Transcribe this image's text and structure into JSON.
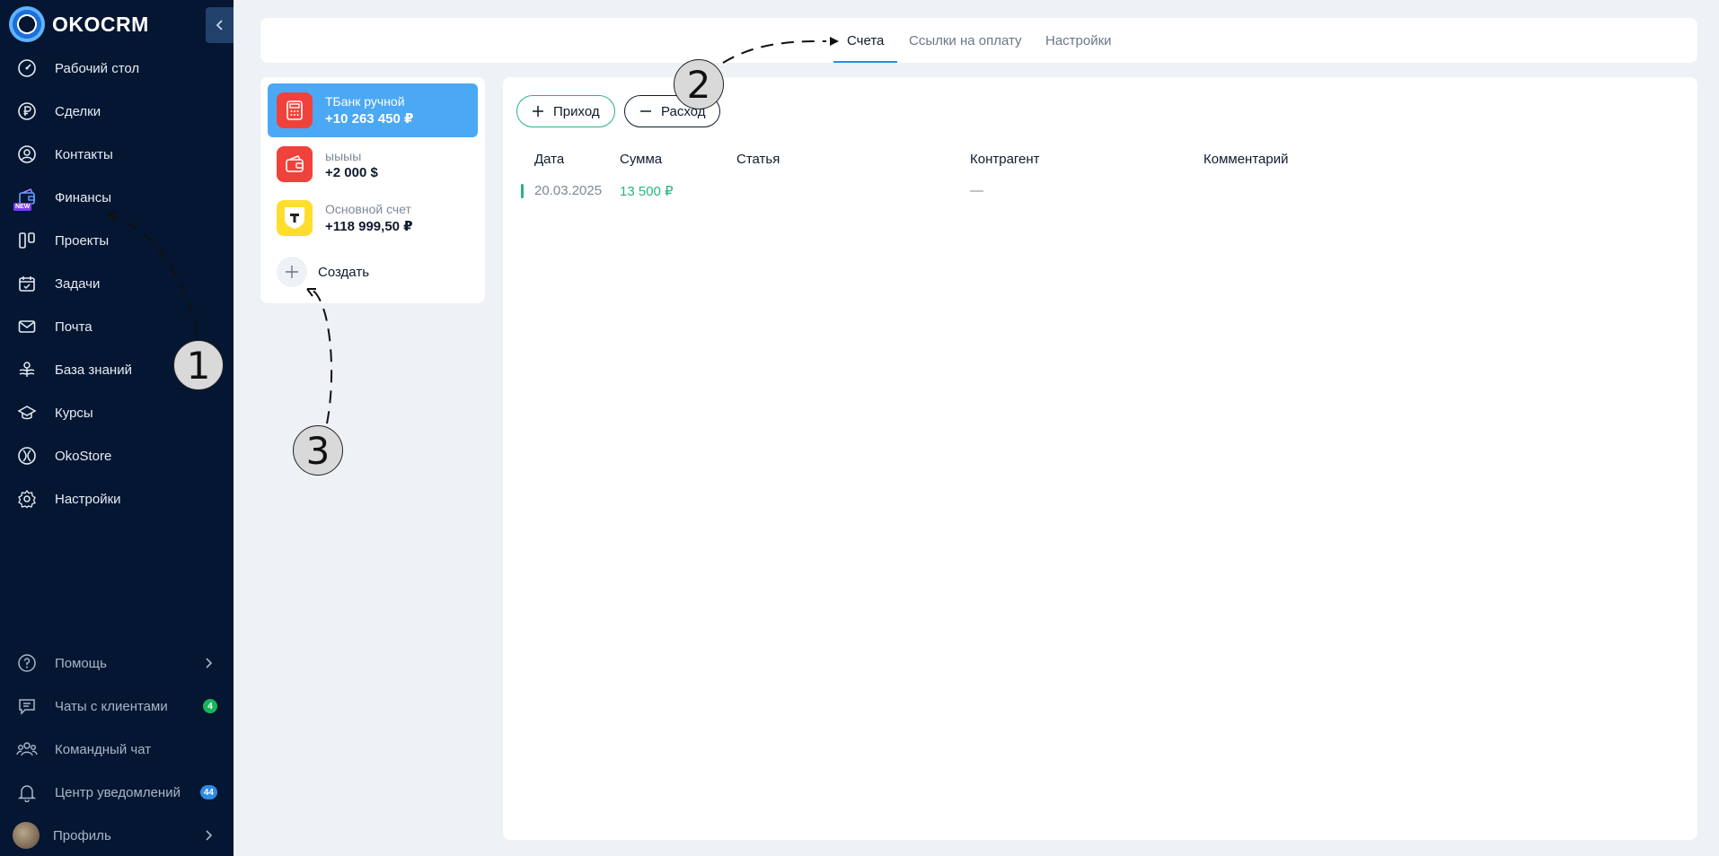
{
  "app": {
    "logo_text": "OKOCRM"
  },
  "sidebar": {
    "items": [
      {
        "label": "Рабочий стол",
        "icon": "dashboard-icon"
      },
      {
        "label": "Сделки",
        "icon": "ruble-icon"
      },
      {
        "label": "Контакты",
        "icon": "contact-icon"
      },
      {
        "label": "Финансы",
        "icon": "finance-icon",
        "badge": "NEW"
      },
      {
        "label": "Проекты",
        "icon": "projects-icon"
      },
      {
        "label": "Задачи",
        "icon": "tasks-icon"
      },
      {
        "label": "Почта",
        "icon": "mail-icon"
      },
      {
        "label": "База знаний",
        "icon": "knowledge-icon"
      },
      {
        "label": "Курсы",
        "icon": "courses-icon"
      },
      {
        "label": "OkoStore",
        "icon": "store-icon"
      },
      {
        "label": "Настройки",
        "icon": "settings-icon"
      }
    ],
    "bottom": [
      {
        "label": "Помощь",
        "icon": "help-icon"
      },
      {
        "label": "Чаты с клиентами",
        "icon": "chat-icon",
        "count": "4"
      },
      {
        "label": "Командный чат",
        "icon": "team-icon"
      },
      {
        "label": "Центр уведомлений",
        "icon": "bell-icon",
        "count": "44"
      },
      {
        "label": "Профиль",
        "icon": "avatar"
      }
    ]
  },
  "tabs": [
    {
      "label": "Счета",
      "active": true
    },
    {
      "label": "Ссылки на оплату",
      "active": false
    },
    {
      "label": "Настройки",
      "active": false
    }
  ],
  "accounts": [
    {
      "name": "ТБанк ручной",
      "balance": "+10 263 450 ₽",
      "icon": "calculator-icon",
      "color": "#f0423a"
    },
    {
      "name": "ыыыы",
      "balance": "+2 000 $",
      "icon": "wallet-icon",
      "color": "#f0423a"
    },
    {
      "name": "Основной счет",
      "balance": "+118 999,50 ₽",
      "icon": "tbank-icon",
      "color": "#ffdd2d"
    }
  ],
  "create_label": "Создать",
  "actions": {
    "income": "Приход",
    "expense": "Расход"
  },
  "table": {
    "headers": [
      "Дата",
      "Сумма",
      "Статья",
      "Контрагент",
      "Комментарий"
    ],
    "rows": [
      {
        "date": "20.03.2025",
        "amount": "13 500 ₽",
        "article": "",
        "counterparty": "—",
        "comment": ""
      }
    ]
  },
  "annotations": [
    "1",
    "2",
    "3"
  ],
  "colors": {
    "sidebar_bg": "#041631",
    "accent": "#2e8be8",
    "income": "#29b383"
  }
}
